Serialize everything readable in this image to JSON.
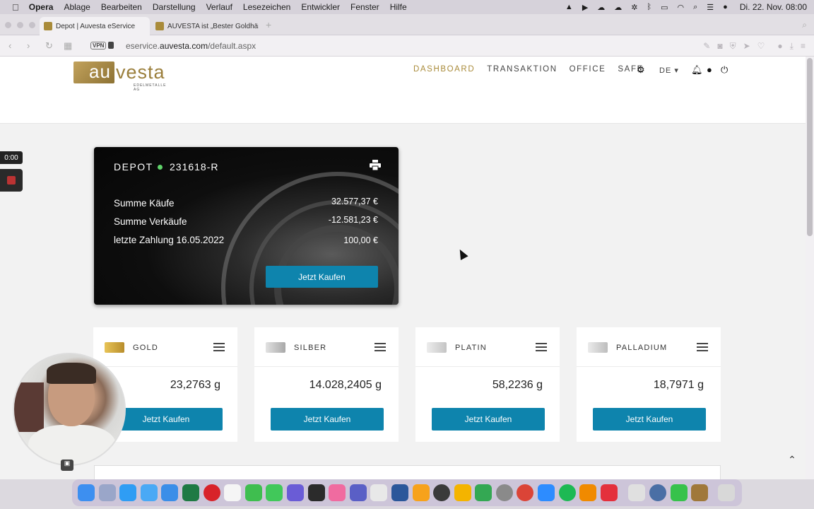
{
  "menubar": {
    "app": "Opera",
    "items": [
      "Ablage",
      "Bearbeiten",
      "Darstellung",
      "Verlauf",
      "Lesezeichen",
      "Entwickler",
      "Fenster",
      "Hilfe"
    ],
    "clock": "Di. 22. Nov.  08:00"
  },
  "tabs": [
    {
      "title": "Depot | Auvesta eService"
    },
    {
      "title": "AUVESTA ist „Bester Goldhändl"
    }
  ],
  "address": {
    "vpn": "VPN",
    "domain_prefix": "eservice.",
    "domain": "auvesta.com",
    "path": "/default.aspx"
  },
  "logo": {
    "box_text": "au",
    "rest_text": "vesta",
    "sub": "EDELMETALLE AG"
  },
  "nav": {
    "dashboard": "DASHBOARD",
    "transaktion": "TRANSAKTION",
    "office": "OFFICE",
    "safe": "SAFE",
    "lang": "DE"
  },
  "depot": {
    "label": "DEPOT",
    "number": "231618-R",
    "rows": [
      {
        "label": "Summe Käufe",
        "value": "32.577,37 €"
      },
      {
        "label": "Summe Verkäufe",
        "value": "-12.581,23 €"
      },
      {
        "label": "letzte Zahlung  16.05.2022",
        "value": "100,00 €"
      }
    ],
    "button": "Jetzt Kaufen"
  },
  "metals": [
    {
      "name": "GOLD",
      "amount": "23,2763 g",
      "button": "Jetzt Kaufen",
      "color": "#d6b04a"
    },
    {
      "name": "SILBER",
      "amount": "14.028,2405 g",
      "button": "Jetzt Kaufen",
      "color": "#bdbdbd"
    },
    {
      "name": "PLATIN",
      "amount": "58,2236 g",
      "button": "Jetzt Kaufen",
      "color": "#d4d4d4"
    },
    {
      "name": "PALLADIUM",
      "amount": "18,7971 g",
      "button": "Jetzt Kaufen",
      "color": "#cfcfcf"
    }
  ],
  "recorder": {
    "time": "0:00"
  },
  "accent": "#0e84ad",
  "gold_accent": "#a98b3a"
}
